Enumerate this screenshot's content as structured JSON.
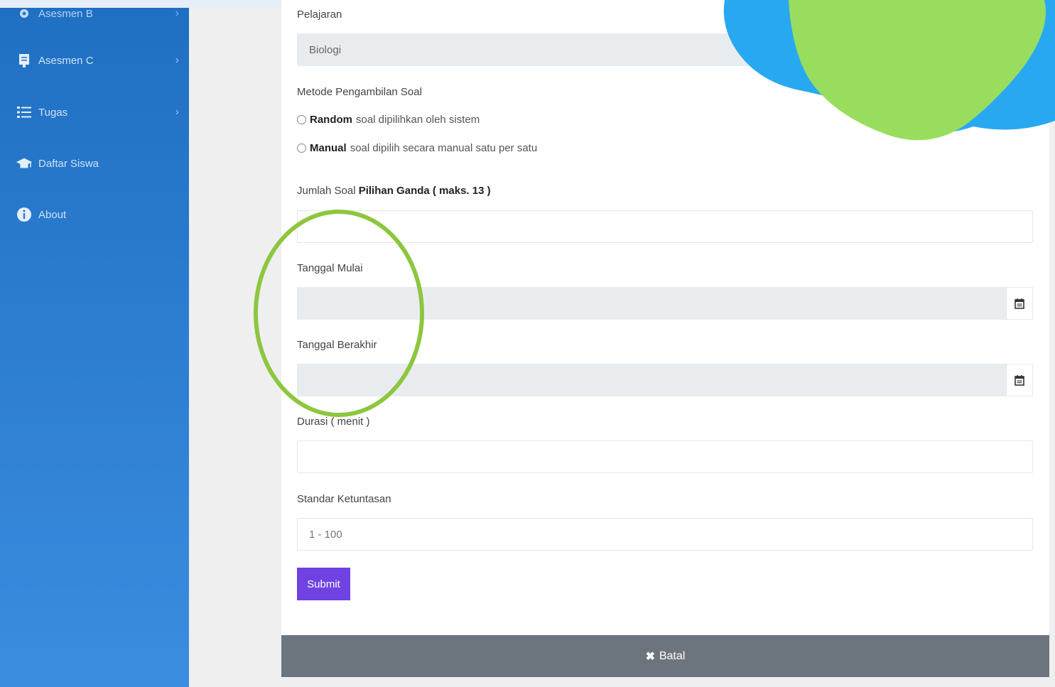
{
  "sidebar": {
    "items": [
      {
        "label": "Asesmen B",
        "icon": "gear-icon",
        "has_chevron": true
      },
      {
        "label": "Asesmen C",
        "icon": "document-icon",
        "has_chevron": true
      },
      {
        "label": "Tugas",
        "icon": "list-icon",
        "has_chevron": true
      },
      {
        "label": "Daftar Siswa",
        "icon": "graduation-cap-icon",
        "has_chevron": false
      },
      {
        "label": "About",
        "icon": "info-icon",
        "has_chevron": false
      }
    ]
  },
  "form": {
    "pelajaran_label": "Pelajaran",
    "pelajaran_value": "Biologi",
    "metode_label": "Metode Pengambilan Soal",
    "option_random_bold": "Random",
    "option_random_rest": "soal dipilihkan oleh sistem",
    "option_manual_bold": "Manual",
    "option_manual_rest": "soal dipilih secara manual satu per satu",
    "jumlah_label_prefix": "Jumlah Soal",
    "jumlah_label_bold": "Pilihan Ganda ( maks. 13 )",
    "jumlah_value": "",
    "tanggal_mulai_label": "Tanggal Mulai",
    "tanggal_berakhir_label": "Tanggal Berakhir",
    "durasi_label": "Durasi ( menit )",
    "standar_label": "Standar Ketuntasan",
    "standar_placeholder": "1 - 100",
    "submit_label": "Submit",
    "cancel_label": "Batal"
  },
  "colors": {
    "sidebar_top": "#1f6fc3",
    "sidebar_bottom": "#3b8de0",
    "submit": "#6f42e1",
    "cancel_bar": "#6c757d",
    "annotation_circle": "#8dc63f",
    "blob_blue": "#29a8f2",
    "blob_green": "#99dd5f"
  }
}
